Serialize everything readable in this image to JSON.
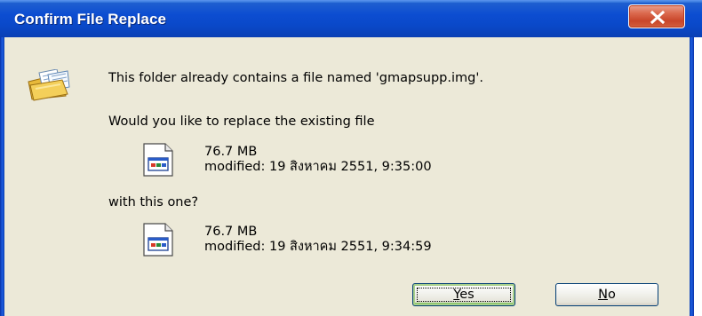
{
  "dialog": {
    "title": "Confirm File Replace",
    "close_label": "Close"
  },
  "icons": {
    "header": "folder-files-icon",
    "existing_file": "file-document-icon",
    "new_file": "file-document-icon",
    "close": "close-x-icon"
  },
  "message": {
    "line1": "This folder already contains a file named 'gmapsupp.img'.",
    "line2": "Would you like to replace the existing file",
    "line3": "with this one?"
  },
  "existing_file": {
    "size": "76.7 MB",
    "modified": "modified: 19 สิงหาคม 2551, 9:35:00"
  },
  "new_file": {
    "size": "76.7 MB",
    "modified": "modified: 19 สิงหาคม 2551, 9:34:59"
  },
  "buttons": {
    "yes": {
      "first": "Y",
      "rest": "es"
    },
    "no": {
      "first": "N",
      "rest": "o"
    }
  },
  "colors": {
    "titlebar": "#0c4dd1",
    "client_background": "#ece9d8",
    "close_button": "#c9462a",
    "default_button_highlight": "#a9d08c"
  }
}
